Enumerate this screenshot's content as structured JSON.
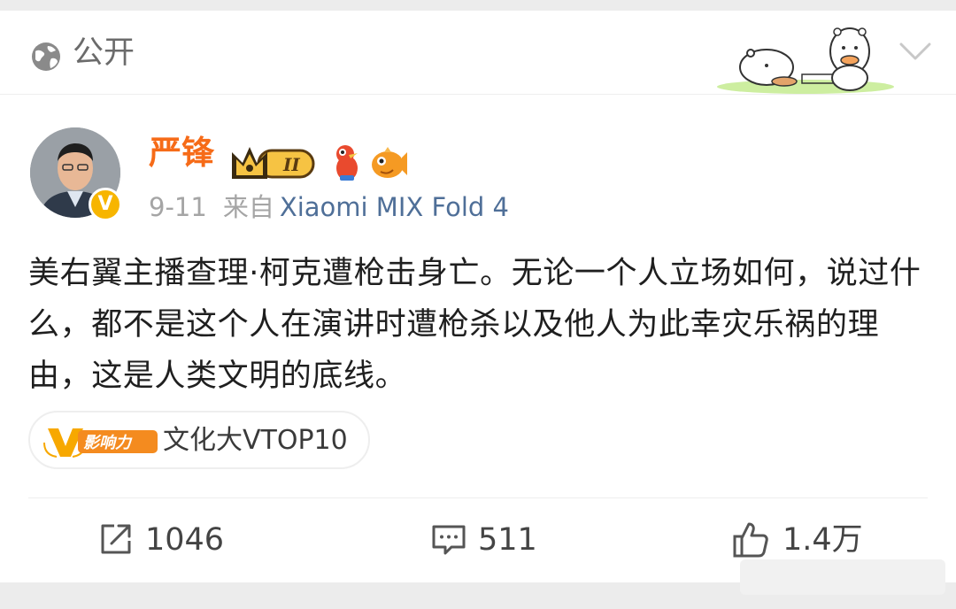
{
  "header": {
    "privacy_label": "公开",
    "privacy_icon": "globe-icon",
    "collapse_icon": "chevron-down-icon"
  },
  "post": {
    "author_name": "严锋",
    "verified_badge": "V",
    "date": "9-11",
    "source_prefix": "来自",
    "device": "Xiaomi MIX Fold 4",
    "level_badge": "II",
    "content": "美右翼主播查理·柯克遭枪击身亡。无论一个人立场如何，说过什么，都不是这个人在演讲时遭枪杀以及他人为此幸灾乐祸的理由，这是人类文明的底线。",
    "influence_tag": {
      "icon_text": "影响力",
      "label": "文化大VTOP10"
    }
  },
  "actions": {
    "repost_count": "1046",
    "comment_count": "511",
    "like_count": "1.4万"
  },
  "colors": {
    "author": "#f66b18",
    "device": "#4f6f98",
    "verified": "#f7b500"
  }
}
